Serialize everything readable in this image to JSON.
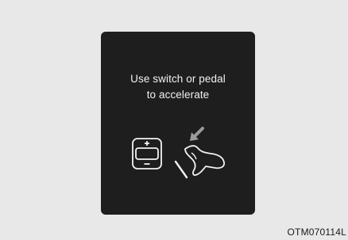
{
  "display": {
    "message_line1": "Use switch or pedal",
    "message_line2": "to accelerate",
    "icons": [
      "switch-plus-minus-icon",
      "accelerator-pedal-foot-icon"
    ],
    "colors": {
      "page_background": "#e8e8e8",
      "screen_background": "#1e1e1e",
      "text_and_icons": "#f2f2f2"
    }
  },
  "figure_code": "OTM070114L"
}
